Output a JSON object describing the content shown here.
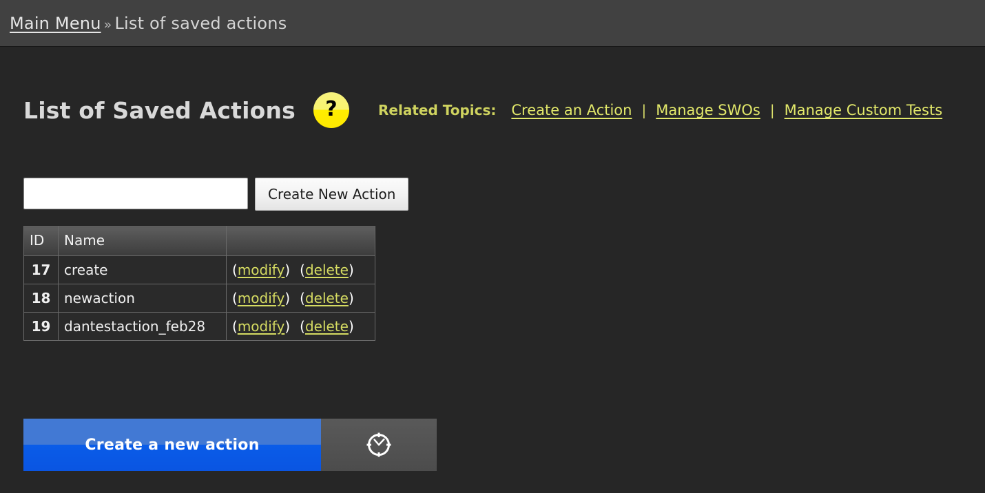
{
  "breadcrumb": {
    "home_label": "Main Menu",
    "separator": "»",
    "current_label": "List of saved actions"
  },
  "header": {
    "title": "List of Saved Actions",
    "help_icon_label": "?",
    "related_topics_label": "Related Topics:",
    "topic_separator": "|",
    "topics": [
      {
        "label": "Create an Action"
      },
      {
        "label": "Manage SWOs"
      },
      {
        "label": "Manage Custom Tests"
      }
    ]
  },
  "create_row": {
    "input_value": "",
    "input_placeholder": "",
    "button_label": "Create New Action"
  },
  "table": {
    "columns": [
      "ID",
      "Name",
      ""
    ],
    "rows": [
      {
        "id": "17",
        "name": "create",
        "modify_label": "modify",
        "delete_label": "delete"
      },
      {
        "id": "18",
        "name": "newaction",
        "modify_label": "modify",
        "delete_label": "delete"
      },
      {
        "id": "19",
        "name": "dantestaction_feb28",
        "modify_label": "modify",
        "delete_label": "delete"
      }
    ],
    "open_paren": "(",
    "close_paren": ")"
  },
  "progress": {
    "label": "Create a new action",
    "percent": 72,
    "icon": "clock-icon"
  },
  "colors": {
    "page_background": "#262626",
    "topbar_background": "#414141",
    "link_yellow": "#e2e86a",
    "help_yellow": "#ffee00",
    "progress_blue": "#0a5ce8",
    "progress_blue_light": "#4279d4",
    "progress_track": "#535353"
  }
}
